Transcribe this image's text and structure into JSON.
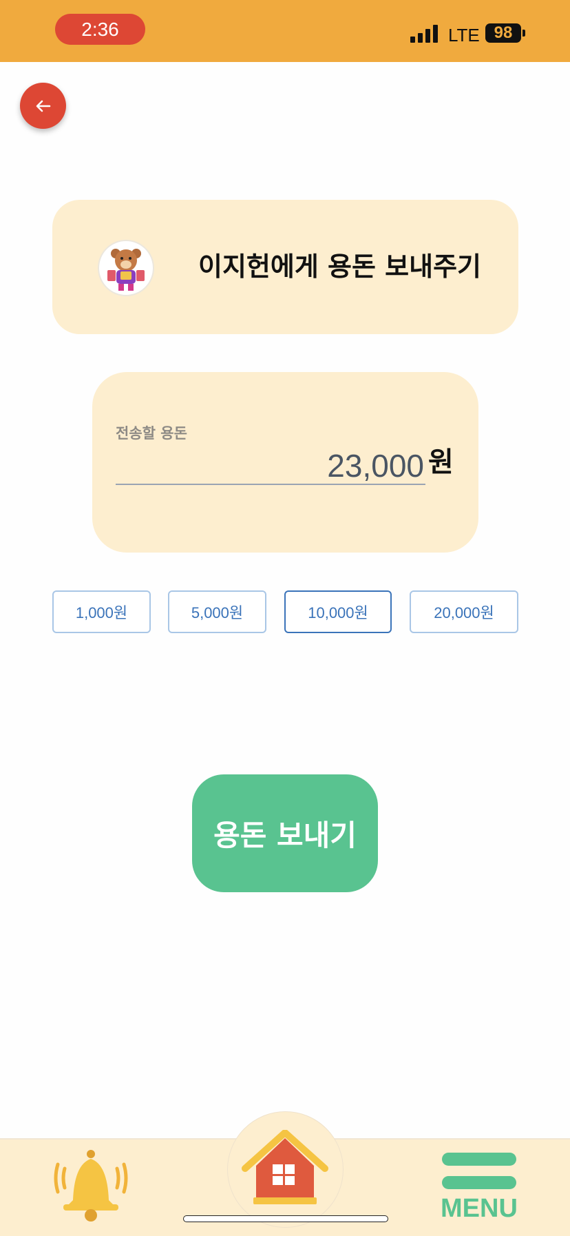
{
  "status": {
    "time": "2:36",
    "network": "LTE",
    "battery": "98"
  },
  "header": {
    "back_icon": "arrow-left-icon"
  },
  "title_card": {
    "title": "이지헌에게 용돈 보내주기"
  },
  "amount": {
    "label": "전송할 용돈",
    "value": "23,000",
    "unit": "원"
  },
  "quick_amounts": [
    "1,000원",
    "5,000원",
    "10,000원",
    "20,000원"
  ],
  "selected_quick_amount": "10,000원",
  "send_button": {
    "label": "용돈 보내기"
  },
  "bottom_nav": {
    "notifications_icon": "bell-icon",
    "home_icon": "house-icon",
    "menu_label": "MENU"
  },
  "colors": {
    "status_bar": "#f0aa3e",
    "accent_red": "#dd4734",
    "card_bg": "#fdeecf",
    "accent_green": "#59c390",
    "chip_blue": "#3a73b9"
  }
}
